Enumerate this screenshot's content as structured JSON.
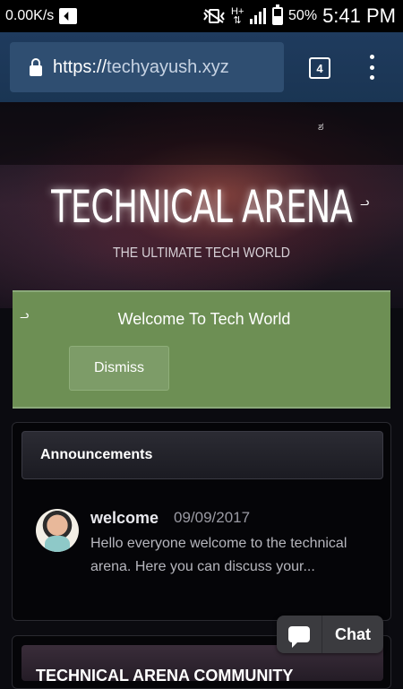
{
  "status_bar": {
    "speed": "0.00K/s",
    "hplus": "H+",
    "battery": "50%",
    "time": "5:41 PM"
  },
  "browser": {
    "url_protocol": "https://",
    "url_rest": "techyayush.xyz",
    "tab_count": "4"
  },
  "hero": {
    "title": "TECHNICAL ARENA",
    "subtitle": "THE ULTIMATE TECH WORLD"
  },
  "notice": {
    "text": "Welcome To Tech World",
    "dismiss_label": "Dismiss"
  },
  "announcements": {
    "header": "Announcements",
    "post": {
      "title": "welcome",
      "date": "09/09/2017",
      "excerpt": "Hello everyone welcome to the technical arena. Here you can discuss your..."
    }
  },
  "next_panel": {
    "header": "TECHNICAL ARENA COMMUNITY"
  },
  "chat": {
    "label": "Chat"
  }
}
